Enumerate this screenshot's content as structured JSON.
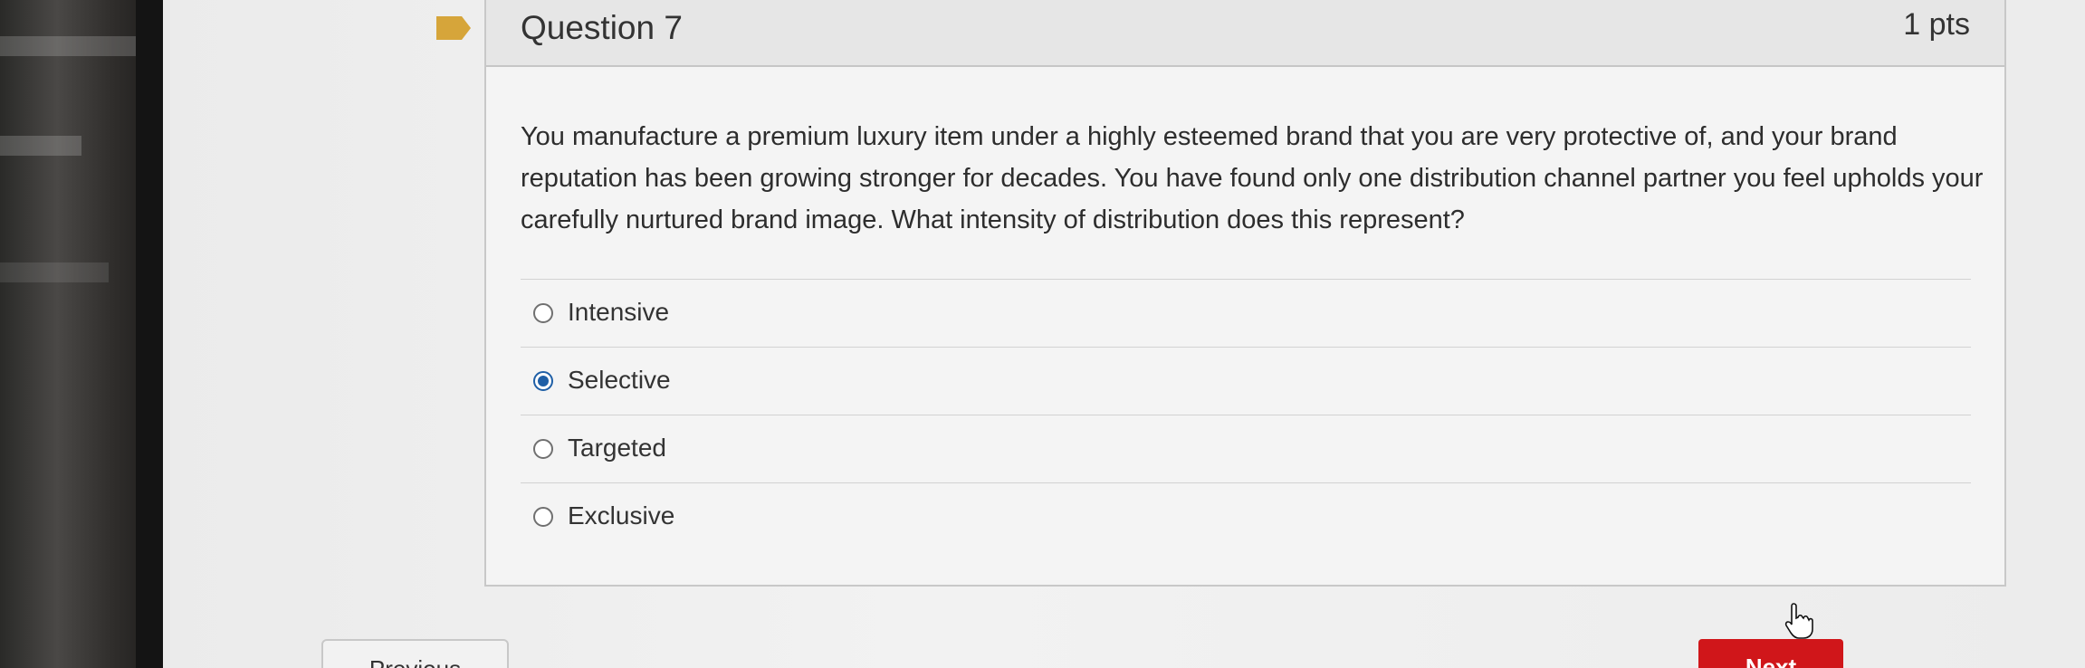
{
  "question": {
    "title": "Question 7",
    "points": "1 pts",
    "text": "You manufacture a premium luxury item under a highly esteemed brand that you are very protective of, and your brand reputation has been growing stronger for decades. You have found only one distribution channel partner you feel upholds your carefully nurtured brand image. What intensity of distribution does this represent?"
  },
  "answers": [
    {
      "label": "Intensive",
      "selected": false
    },
    {
      "label": "Selective",
      "selected": true
    },
    {
      "label": "Targeted",
      "selected": false
    },
    {
      "label": "Exclusive",
      "selected": false
    }
  ],
  "nav": {
    "previous_label": "Previous",
    "next_label": "Next"
  },
  "colors": {
    "flag": "#d6a53a",
    "selected_radio": "#1f5fa6",
    "next_button": "#d0161a"
  },
  "icons": {
    "flag": "flag-icon",
    "cursor": "hand-pointer-icon"
  }
}
